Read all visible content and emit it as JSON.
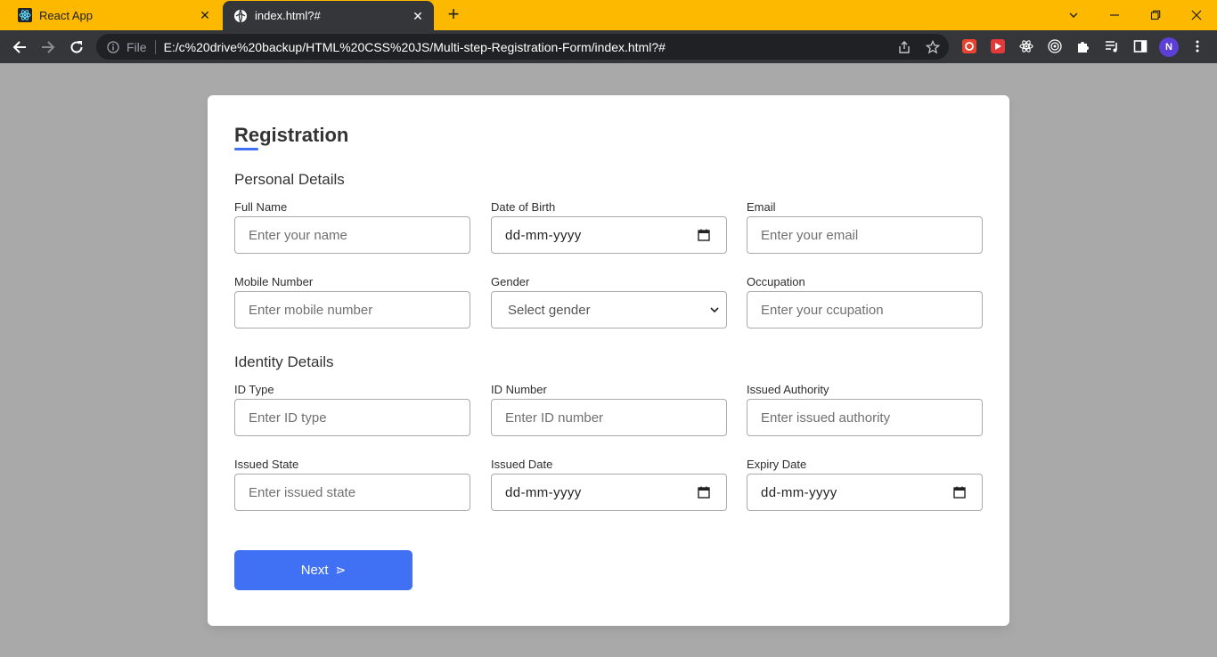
{
  "browser": {
    "tabs": [
      {
        "title": "React App",
        "favicon": "react-icon",
        "active": false
      },
      {
        "title": "index.html?#",
        "favicon": "globe-icon",
        "active": true
      }
    ],
    "omnibox": {
      "scheme_label": "File",
      "url": "E:/c%20drive%20backup/HTML%20CSS%20JS/Multi-step-Registration-Form/index.html?#"
    },
    "profile_initial": "N",
    "colors": {
      "tab_strip": "#fdb900",
      "toolbar": "#35363a",
      "profile": "#5b3fd6"
    }
  },
  "form": {
    "title": "Registration",
    "accent_color": "#4070f4",
    "sections": [
      {
        "title": "Personal Details",
        "fields": [
          {
            "label": "Full Name",
            "placeholder": "Enter your name",
            "type": "text"
          },
          {
            "label": "Date of Birth",
            "placeholder": "dd-mm-yyyy",
            "type": "date"
          },
          {
            "label": "Email",
            "placeholder": "Enter your email",
            "type": "text"
          },
          {
            "label": "Mobile Number",
            "placeholder": "Enter mobile number",
            "type": "text"
          },
          {
            "label": "Gender",
            "placeholder": "Select gender",
            "type": "select"
          },
          {
            "label": "Occupation",
            "placeholder": "Enter your ccupation",
            "type": "text"
          }
        ]
      },
      {
        "title": "Identity Details",
        "fields": [
          {
            "label": "ID Type",
            "placeholder": "Enter ID type",
            "type": "text"
          },
          {
            "label": "ID Number",
            "placeholder": "Enter ID number",
            "type": "text"
          },
          {
            "label": "Issued Authority",
            "placeholder": "Enter issued authority",
            "type": "text"
          },
          {
            "label": "Issued State",
            "placeholder": "Enter issued state",
            "type": "text"
          },
          {
            "label": "Issued Date",
            "placeholder": "dd-mm-yyyy",
            "type": "date"
          },
          {
            "label": "Expiry Date",
            "placeholder": "dd-mm-yyyy",
            "type": "date"
          }
        ]
      }
    ],
    "next_button": {
      "label": "Next",
      "icon": "send-arrow-icon",
      "glyph": "⋗"
    }
  }
}
